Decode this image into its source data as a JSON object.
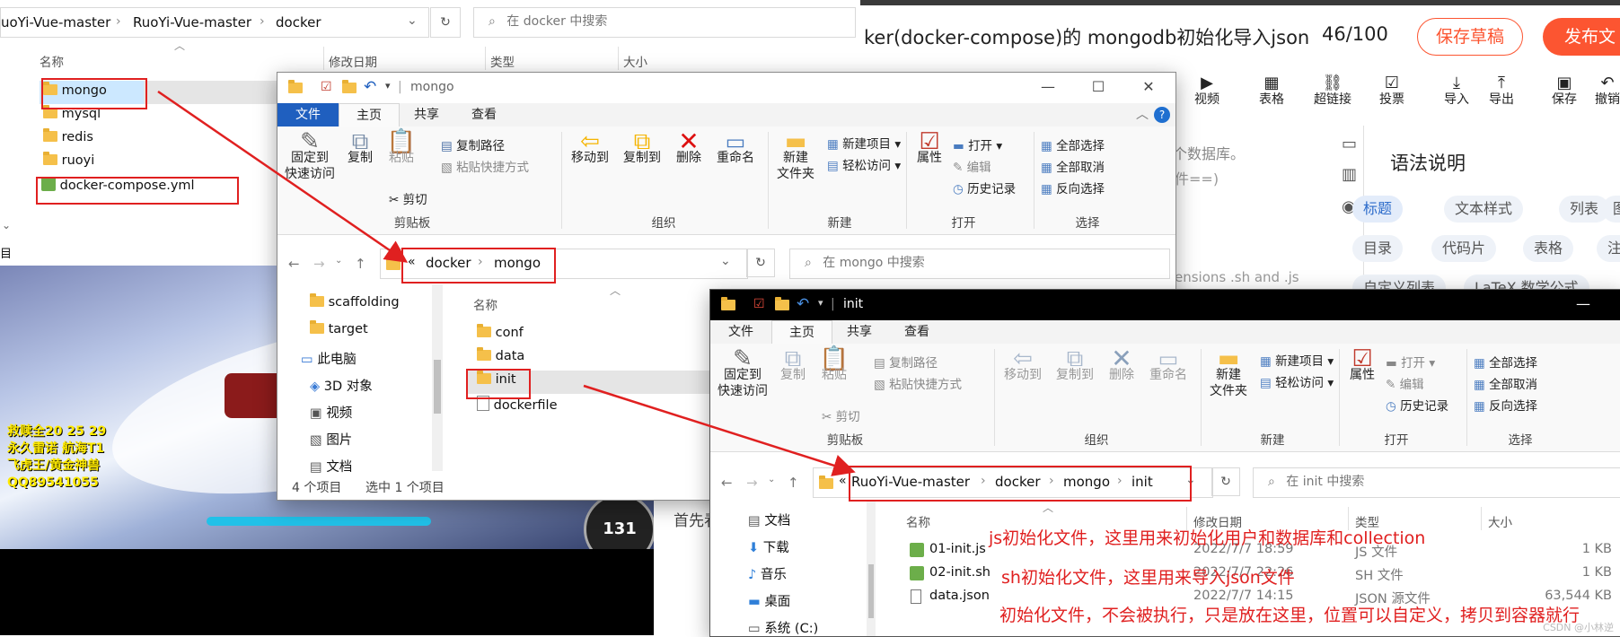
{
  "top_explorer": {
    "breadcrumb": [
      "uoYi-Vue-master",
      "RuoYi-Vue-master",
      "docker"
    ],
    "search_placeholder": "在 docker 中搜索",
    "headers": [
      "名称",
      "修改日期",
      "类型",
      "大小"
    ],
    "items": [
      "mongo",
      "mysql",
      "redis",
      "ruoyi",
      "docker-compose.yml"
    ],
    "left_cut": "目"
  },
  "editor": {
    "title": "ker(docker-compose)的 mongodb初始化导入json",
    "counter": "46/100",
    "save_draft": "保存草稿",
    "publish": "发布文",
    "toolbar": [
      "视频",
      "表格",
      "超链接",
      "投票",
      "导入",
      "导出",
      "保存",
      "撤销"
    ],
    "body_lines": [
      "个数据库。",
      "件==)",
      "ensions .sh and .js",
      "首先看"
    ],
    "syntax_title": "语法说明",
    "chips": [
      "标题",
      "文本样式",
      "列表",
      "图",
      "目录",
      "代码片",
      "表格",
      "注脚",
      "自定义列表",
      "LaTeX 数学公式"
    ]
  },
  "game": {
    "lines": [
      "救赎全20 25 29",
      "永久雷诺 航海T1",
      "飞虎王/黄金神兽",
      "QQ89541055"
    ],
    "speed": "131"
  },
  "mongo_window": {
    "title": "mongo",
    "tabs": [
      "文件",
      "主页",
      "共享",
      "查看"
    ],
    "ribbon": {
      "pin": "固定到\n快速访问",
      "copy": "复制",
      "paste": "粘贴",
      "copy_path": "复制路径",
      "paste_shortcut": "粘贴快捷方式",
      "cut": "剪切",
      "clipboard": "剪贴板",
      "move_to": "移动到",
      "copy_to": "复制到",
      "delete": "删除",
      "rename": "重命名",
      "organize": "组织",
      "new_folder": "新建\n文件夹",
      "new_item": "新建项目",
      "easy_access": "轻松访问",
      "new": "新建",
      "properties": "属性",
      "open": "打开",
      "edit": "编辑",
      "history": "历史记录",
      "open_group": "打开",
      "select_all": "全部选择",
      "select_none": "全部取消",
      "invert": "反向选择",
      "select_group": "选择"
    },
    "address": [
      "«",
      "docker",
      "mongo"
    ],
    "search_placeholder": "在 mongo 中搜索",
    "nav": [
      "scaffolding",
      "target",
      "此电脑",
      "3D 对象",
      "视频",
      "图片",
      "文档"
    ],
    "header_name": "名称",
    "items": [
      "conf",
      "data",
      "init",
      "dockerfile"
    ],
    "status_count": "4 个项目",
    "status_selected": "选中 1 个项目"
  },
  "init_window": {
    "title": "init",
    "tabs": [
      "文件",
      "主页",
      "共享",
      "查看"
    ],
    "address": [
      "RuoYi-Vue-master",
      "docker",
      "mongo",
      "init"
    ],
    "search_placeholder": "在 init 中搜索",
    "nav": [
      "文档",
      "下载",
      "音乐",
      "桌面",
      "系统 (C:)"
    ],
    "headers": [
      "名称",
      "修改日期",
      "类型",
      "大小"
    ],
    "files": [
      {
        "name": "01-init.js",
        "date": "2022/7/7 18:59",
        "type": "JS 文件",
        "size": "1 KB"
      },
      {
        "name": "02-init.sh",
        "date": "2022/7/7 22:26",
        "type": "SH 文件",
        "size": "1 KB"
      },
      {
        "name": "data.json",
        "date": "2022/7/7 14:15",
        "type": "JSON 源文件",
        "size": "63,544 KB"
      }
    ],
    "annotations": [
      "js初始化文件，这里用来初始化用户和数据库和collection",
      "sh初始化文件，这里用来导入json文件",
      "初始化文件，不会被执行，只是放在这里，位置可以自定义，拷贝到容器就行"
    ],
    "watermark": "CSDN @小林逆"
  },
  "colors": {
    "annotation_red": "#e02020",
    "file_tab_blue": "#1f5fbf",
    "publish_orange": "#fc5531"
  }
}
